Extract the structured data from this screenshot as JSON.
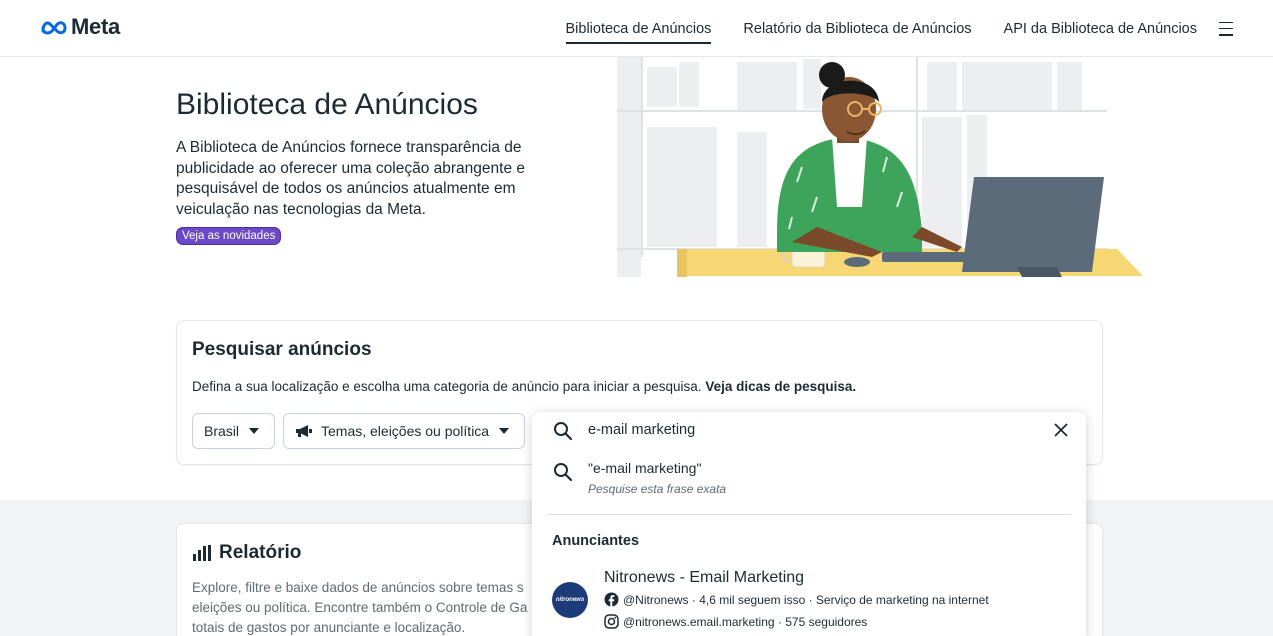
{
  "header": {
    "logo_text": "Meta",
    "nav": [
      {
        "label": "Biblioteca de Anúncios",
        "active": true
      },
      {
        "label": "Relatório da Biblioteca de Anúncios",
        "active": false
      },
      {
        "label": "API da Biblioteca de Anúncios",
        "active": false
      }
    ],
    "menu_icon": "hamburger-menu-icon"
  },
  "hero": {
    "title": "Biblioteca de Anúncios",
    "description_lines": [
      "A Biblioteca de Anúncios fornece transparência de",
      "publicidade ao oferecer uma coleção abrangente e",
      "pesquisável de todos os anúncios atualmente em",
      "veiculação nas tecnologias da Meta."
    ],
    "badge": "Veja as novidades"
  },
  "search_card": {
    "title": "Pesquisar anúncios",
    "description": "Defina a sua localização e escolha uma categoria de anúncio para iniciar a pesquisa.",
    "tips_link": "Veja dicas de pesquisa.",
    "country": "Brasil",
    "category": "Temas, eleições ou política"
  },
  "search_dropdown": {
    "query": "e-mail marketing",
    "exact_phrase": "\"e-mail marketing\"",
    "exact_phrase_hint": "Pesquise esta frase exata",
    "section_title": "Anunciantes",
    "advertiser": {
      "avatar_text": "nitronews",
      "name": "Nitronews - Email Marketing",
      "facebook_line": "@Nitronews · 4,6 mil seguem isso · Serviço de marketing na internet",
      "instagram_line": "@nitronews.email.marketing · 575 seguidores"
    }
  },
  "report_card": {
    "title": "Relatório",
    "description_lines": [
      "Explore, filtre e baixe dados de anúncios sobre temas s",
      "eleições ou política. Encontre também o Controle de Ga",
      "totais de gastos por anunciante e localização."
    ]
  },
  "colors": {
    "text": "#1c2b33",
    "badge": "#6b48c8",
    "border": "#cbd2d9",
    "gray_section": "#f1f4f7"
  }
}
